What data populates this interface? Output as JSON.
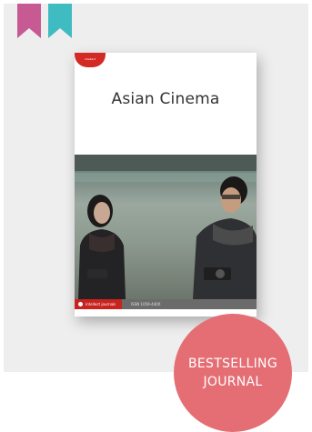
{
  "bookmarks": [
    {
      "icon": "bookmark-icon",
      "color": "#c75a93"
    },
    {
      "icon": "bookmark-icon",
      "color": "#3fbcc2"
    }
  ],
  "cover": {
    "publisher_tag": "intellect",
    "title": "Asian Cinema",
    "footer_brand": "intellect journals",
    "footer_issn": "ISSN 1059-440X"
  },
  "badge": {
    "line1": "BESTSELLING",
    "line2": "JOURNAL",
    "color": "#e46e73"
  }
}
